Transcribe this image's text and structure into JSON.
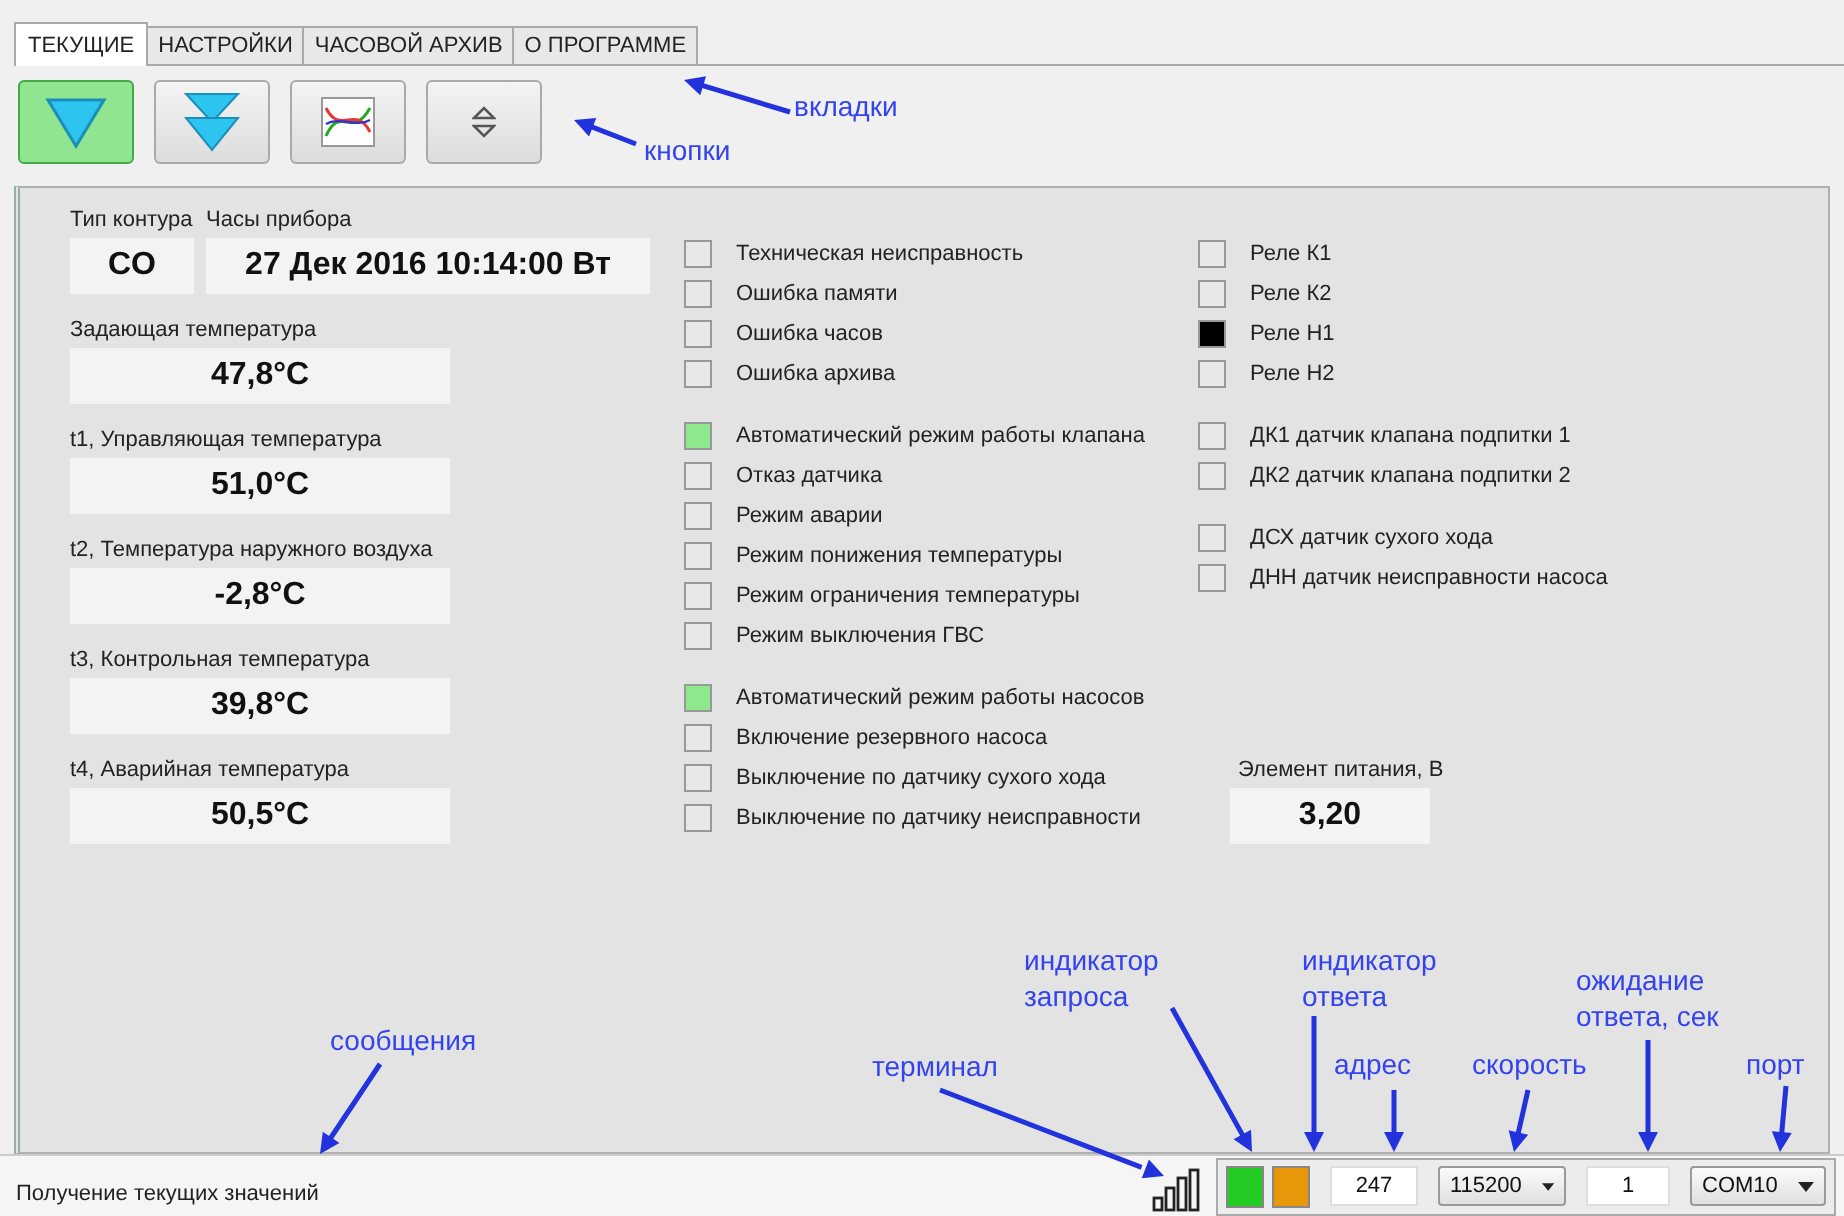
{
  "tabs": [
    {
      "label": "ТЕКУЩИЕ",
      "selected": true
    },
    {
      "label": "НАСТРОЙКИ",
      "selected": false
    },
    {
      "label": "ЧАСОВОЙ АРХИВ",
      "selected": false
    },
    {
      "label": "О ПРОГРАММЕ",
      "selected": false
    }
  ],
  "toolbar": [
    {
      "kind": "down",
      "selected": true
    },
    {
      "kind": "double_down",
      "selected": false
    },
    {
      "kind": "chart",
      "selected": false
    },
    {
      "kind": "updown",
      "selected": false
    }
  ],
  "circuit_type": {
    "label": "Тип контура",
    "value": "CO"
  },
  "device_clock": {
    "label": "Часы прибора",
    "value": "27 Дек 2016 10:14:00 Вт"
  },
  "temperatures": [
    {
      "label": "Задающая температура",
      "value": "47,8°C"
    },
    {
      "label": "t1, Управляющая температура",
      "value": "51,0°C"
    },
    {
      "label": "t2, Температура наружного воздуха",
      "value": "-2,8°C"
    },
    {
      "label": "t3, Контрольная температура",
      "value": "39,8°C"
    },
    {
      "label": "t4, Аварийная температура",
      "value": "50,5°C"
    }
  ],
  "flag_groups": [
    [
      {
        "label": "Техническая неисправность",
        "checked": false
      },
      {
        "label": "Ошибка памяти",
        "checked": false
      },
      {
        "label": "Ошибка часов",
        "checked": false
      },
      {
        "label": "Ошибка архива",
        "checked": false
      }
    ],
    [
      {
        "label": "Автоматический режим работы клапана",
        "checked": true,
        "color": "#8ee88e"
      },
      {
        "label": "Отказ датчика",
        "checked": false
      },
      {
        "label": "Режим аварии",
        "checked": false
      },
      {
        "label": "Режим понижения температуры",
        "checked": false
      },
      {
        "label": "Режим ограничения температуры",
        "checked": false
      },
      {
        "label": "Режим выключения ГВС",
        "checked": false
      }
    ],
    [
      {
        "label": "Автоматический режим работы насосов",
        "checked": true,
        "color": "#8ee88e"
      },
      {
        "label": "Включение резервного насоса",
        "checked": false
      },
      {
        "label": "Выключение по датчику сухого хода",
        "checked": false
      },
      {
        "label": "Выключение по датчику неисправности",
        "checked": false
      }
    ]
  ],
  "relay_groups": [
    [
      {
        "label": "Реле К1",
        "checked": false
      },
      {
        "label": "Реле К2",
        "checked": false
      },
      {
        "label": "Реле Н1",
        "checked": true,
        "color": "#000000"
      },
      {
        "label": "Реле Н2",
        "checked": false
      }
    ],
    [
      {
        "label": "ДК1 датчик клапана подпитки 1",
        "checked": false
      },
      {
        "label": "ДК2 датчик клапана подпитки 2",
        "checked": false
      }
    ],
    [
      {
        "label": "ДСХ датчик сухого хода",
        "checked": false
      },
      {
        "label": "ДНН датчик неисправности насоса",
        "checked": false
      }
    ]
  ],
  "battery": {
    "label": "Элемент питания, В",
    "value": "3,20"
  },
  "status_bar": {
    "message": "Получение текущих значений",
    "request_indicator": {
      "color": "#22cc22"
    },
    "response_indicator": {
      "color": "#e8960a"
    },
    "address": "247",
    "speed": "115200",
    "timeout": "1",
    "port": "COM10"
  },
  "annotations": [
    "вкладки",
    "кнопки",
    "сообщения",
    "терминал",
    "индикатор\nзапроса",
    "индикатор\nответа",
    "адрес",
    "скорость",
    "ожидание\nответа, сек",
    "порт"
  ]
}
